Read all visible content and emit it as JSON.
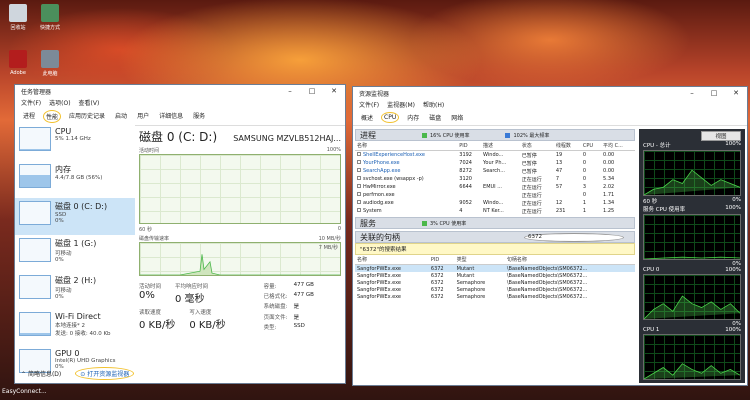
{
  "desktop": {
    "icons": [
      {
        "label": "回收站"
      },
      {
        "label": "快捷方式"
      },
      {
        "label": "Adobe"
      },
      {
        "label": "此电脑"
      }
    ],
    "bottom_label": "EasyConnect..."
  },
  "taskmgr": {
    "title": "任务管理器",
    "menu": [
      "文件(F)",
      "选项(O)",
      "查看(V)"
    ],
    "tabs": [
      "进程",
      "性能",
      "应用历史记录",
      "启动",
      "用户",
      "详细信息",
      "服务"
    ],
    "side": [
      {
        "name": "CPU",
        "l1": "5% 1.14 GHz",
        "l2": "",
        "level": 0.05
      },
      {
        "name": "内存",
        "l1": "4.4/7.8 GB (56%)",
        "l2": "",
        "level": 0.56
      },
      {
        "name": "磁盘 0 (C: D:)",
        "l1": "SSD",
        "l2": "0%",
        "level": 0.02
      },
      {
        "name": "磁盘 1 (G:)",
        "l1": "可移动",
        "l2": "0%",
        "level": 0
      },
      {
        "name": "磁盘 2 (H:)",
        "l1": "可移动",
        "l2": "0%",
        "level": 0
      },
      {
        "name": "Wi-Fi Direct",
        "l1": "本地连接* 2",
        "l2": "发送: 0 接收: 40.0 Kb",
        "level": 0.1
      },
      {
        "name": "GPU 0",
        "l1": "Intel(R) UHD Graphics",
        "l2": "0%",
        "level": 0.02
      }
    ],
    "main": {
      "title": "磁盘 0 (C: D:)",
      "model": "SAMSUNG MZVLB512HAJ...",
      "g1_left": "活动时间",
      "g1_right": "100%",
      "g1_bottom_left": "60 秒",
      "g1_bottom_right": "0",
      "g2_left": "磁盘传输速率",
      "g2_right": "10 MB/秒",
      "g2_sub": "7 MB/秒",
      "stat1_k": "活动时间",
      "stat1_v": "0%",
      "stat2_k": "平均响应时间",
      "stat2_v": "0 毫秒",
      "stat3_k": "读取速度",
      "stat3_v": "0 KB/秒",
      "stat4_k": "写入速度",
      "stat4_v": "0 KB/秒",
      "kv": [
        {
          "k": "容量:",
          "v": "477 GB"
        },
        {
          "k": "已格式化:",
          "v": "477 GB"
        },
        {
          "k": "系统磁盘:",
          "v": "是"
        },
        {
          "k": "页面文件:",
          "v": "是"
        },
        {
          "k": "类型:",
          "v": "SSD"
        }
      ]
    },
    "footer": {
      "brief": "简略信息(D)",
      "open_rm": "打开资源监视器"
    }
  },
  "resmon": {
    "title": "资源监视器",
    "menu": [
      "文件(F)",
      "监视器(M)",
      "帮助(H)"
    ],
    "tabs": [
      "概述",
      "CPU",
      "内存",
      "磁盘",
      "网络"
    ],
    "proc": {
      "header": "进程",
      "usage": "16% CPU 使用率",
      "maxfreq": "102% 最大频率",
      "cols": [
        "名称",
        "PID",
        "描述",
        "状态",
        "线程数",
        "CPU",
        "平均 C..."
      ],
      "rows": [
        [
          "ShellExperienceHost.exe",
          "3192",
          "Windo...",
          "已暂停",
          "19",
          "0",
          "0.00"
        ],
        [
          "YourPhone.exe",
          "7024",
          "Your Ph...",
          "已暂停",
          "13",
          "0",
          "0.00"
        ],
        [
          "SearchApp.exe",
          "8272",
          "Search...",
          "已暂停",
          "47",
          "0",
          "0.00"
        ],
        [
          "svchost.exe (wsappx -p)",
          "3120",
          "",
          "正在运行",
          "7",
          "0",
          "5.34"
        ],
        [
          "HwMirror.exe",
          "6644",
          "EMUI ...",
          "正在运行",
          "57",
          "3",
          "2.02"
        ],
        [
          "perfmon.exe",
          "",
          "",
          "正在运行",
          "",
          "0",
          "1.71"
        ],
        [
          "audiodg.exe",
          "9052",
          "Windo...",
          "正在运行",
          "12",
          "1",
          "1.34"
        ],
        [
          "System",
          "4",
          "NT Ker...",
          "正在运行",
          "231",
          "1",
          "1.25"
        ]
      ]
    },
    "services": {
      "header": "服务",
      "usage": "3% CPU 使用率"
    },
    "handles": {
      "header": "关联的句柄",
      "search": "6372",
      "result": "\"6372\"的搜索结果",
      "cols": [
        "名称",
        "PID",
        "类型",
        "句柄名称"
      ],
      "rows": [
        [
          "SangforPWEx.exe",
          "6372",
          "Mutant",
          "\\BaseNamedObjects\\SM06372..."
        ],
        [
          "SangforPWEx.exe",
          "6372",
          "Mutant",
          "\\BaseNamedObjects\\SM06372..."
        ],
        [
          "SangforPWEx.exe",
          "6372",
          "Semaphore",
          "\\BaseNamedObjects\\SM06372..."
        ],
        [
          "SangforPWEx.exe",
          "6372",
          "Semaphore",
          "\\BaseNamedObjects\\SM06372..."
        ],
        [
          "SangforPWEx.exe",
          "6372",
          "Semaphore",
          "\\BaseNamedObjects\\SM06372..."
        ]
      ]
    },
    "right": {
      "view": "视图",
      "graphs": [
        {
          "top_l": "CPU - 总计",
          "top_r": "100%",
          "bot_l": "60 秒",
          "bot_r": "0%"
        },
        {
          "top_l": "服务 CPU 使用率",
          "top_r": "100%",
          "bot_l": "",
          "bot_r": "0%"
        },
        {
          "top_l": "CPU 0",
          "top_r": "100%",
          "bot_l": "",
          "bot_r": "0%"
        },
        {
          "top_l": "CPU 1",
          "top_r": "100%",
          "bot_l": "",
          "bot_r": ""
        }
      ]
    }
  },
  "colors": {
    "accent": "#1a5fb4",
    "highlight": "#f2c230",
    "graph_green": "#4bb84b"
  }
}
